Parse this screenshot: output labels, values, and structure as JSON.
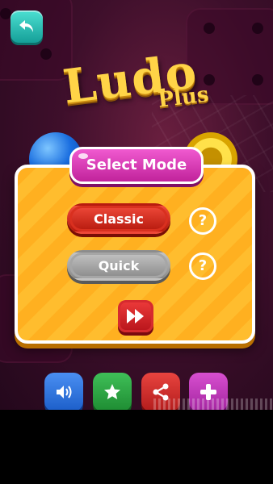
{
  "logo": {
    "main": "Ludo",
    "sub": "Plus"
  },
  "dialog": {
    "title": "Select Mode",
    "classic_label": "Classic",
    "quick_label": "Quick",
    "help_symbol": "?"
  },
  "icons": {
    "back": "back-arrow-icon",
    "play": "fast-forward-icon",
    "sound": "speaker-icon",
    "rate": "star-icon",
    "share": "share-icon",
    "more": "plus-icon"
  },
  "colors": {
    "panel": "#ffb020",
    "title_pill": "#d93cb8",
    "classic": "#d92a1e",
    "quick": "#a8a8a8",
    "back": "#2cc2b8"
  }
}
